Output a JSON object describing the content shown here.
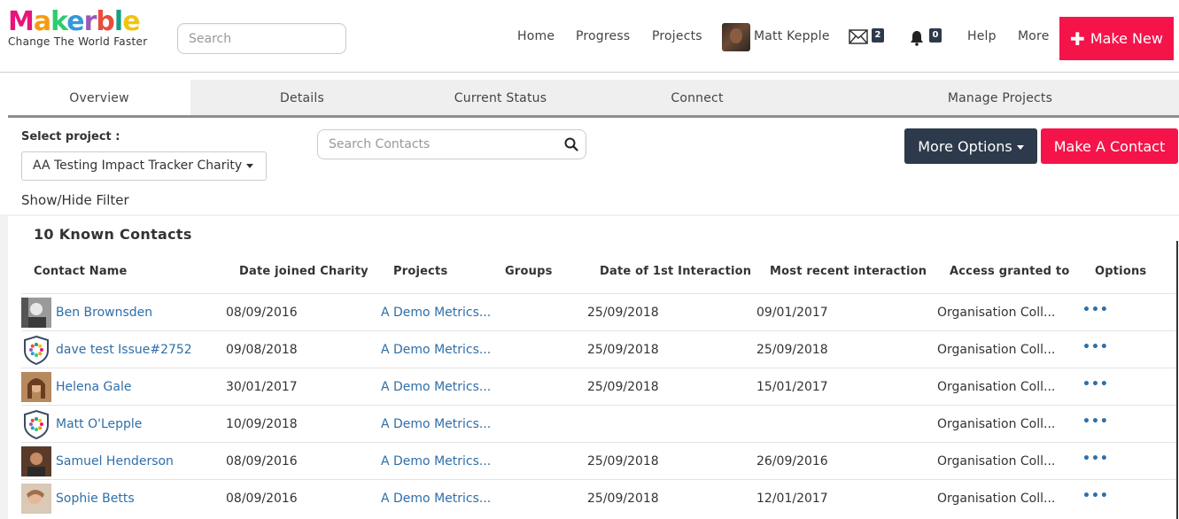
{
  "header": {
    "logo_text": "Makerble",
    "tagline": "Change The World Faster",
    "search_placeholder": "Search",
    "nav": {
      "home": "Home",
      "progress": "Progress",
      "projects": "Projects",
      "user_name": "Matt Kepple",
      "messages_count": "2",
      "notifications_count": "0",
      "help": "Help",
      "more": "More"
    },
    "make_new_label": "Make New"
  },
  "tabs": [
    {
      "label": "Overview",
      "active": true
    },
    {
      "label": "Details"
    },
    {
      "label": "Current Status"
    },
    {
      "label": "Connect"
    },
    {
      "label": "Manage Projects"
    }
  ],
  "controls": {
    "select_label": "Select project :",
    "selected_project": "AA Testing Impact Tracker Charity",
    "contact_search_placeholder": "Search Contacts",
    "more_options_label": "More Options",
    "make_contact_label": "Make A Contact",
    "filter_toggle": "Show/Hide Filter"
  },
  "panel": {
    "title": "10 Known Contacts",
    "columns": [
      "Contact Name",
      "Date joined Charity",
      "Projects",
      "Groups",
      "Date of 1st Interaction",
      "Most recent interaction",
      "Access granted to",
      "Options"
    ],
    "rows": [
      {
        "name": "Ben Brownsden",
        "avatar": "photo-bw",
        "joined": "08/09/2016",
        "projects": "A Demo Metrics...",
        "groups": "",
        "first": "25/09/2018",
        "recent": "09/01/2017",
        "access": "Organisation Coll...",
        "options": "•••"
      },
      {
        "name": "dave test Issue#2752",
        "avatar": "shield-logo",
        "joined": "09/08/2018",
        "projects": "A Demo Metrics...",
        "groups": "",
        "first": "25/09/2018",
        "recent": "25/09/2018",
        "access": "Organisation Coll...",
        "options": "•••"
      },
      {
        "name": "Helena Gale",
        "avatar": "photo-warm",
        "joined": "30/01/2017",
        "projects": "A Demo Metrics...",
        "groups": "",
        "first": "25/09/2018",
        "recent": "15/01/2017",
        "access": "Organisation Coll...",
        "options": "•••"
      },
      {
        "name": "Matt O'Lepple",
        "avatar": "shield-logo",
        "joined": "10/09/2018",
        "projects": "A Demo Metrics...",
        "groups": "",
        "first": "",
        "recent": "",
        "access": "Organisation Coll...",
        "options": "•••"
      },
      {
        "name": "Samuel Henderson",
        "avatar": "photo-warm2",
        "joined": "08/09/2016",
        "projects": "A Demo Metrics...",
        "groups": "",
        "first": "25/09/2018",
        "recent": "26/09/2016",
        "access": "Organisation Coll...",
        "options": "•••"
      },
      {
        "name": "Sophie Betts",
        "avatar": "photo-light",
        "joined": "08/09/2016",
        "projects": "A Demo Metrics...",
        "groups": "",
        "first": "25/09/2018",
        "recent": "12/01/2017",
        "access": "Organisation Coll...",
        "options": "•••"
      }
    ]
  },
  "colors": {
    "brand_red": "#f4144a",
    "navy": "#2d3a4b",
    "link_blue": "#2f6ea8"
  }
}
